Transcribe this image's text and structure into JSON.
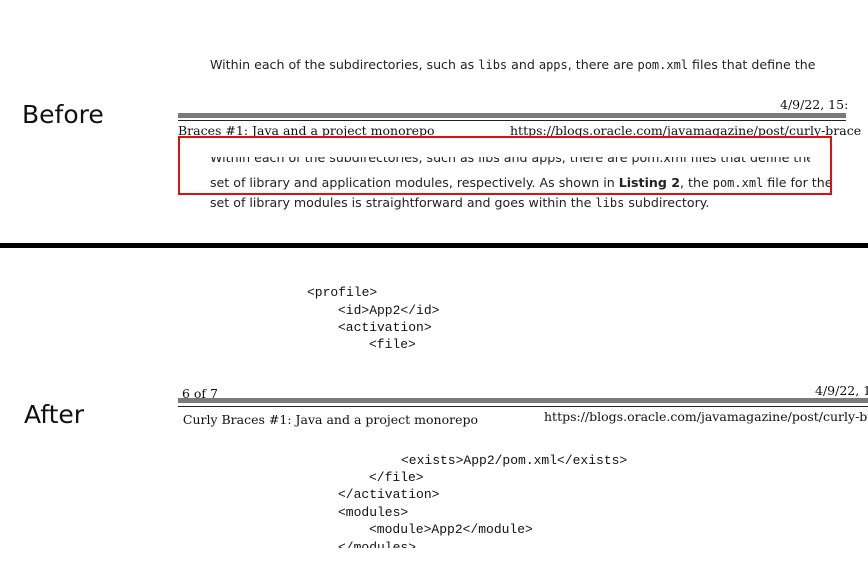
{
  "before": {
    "label": "Before",
    "para_top": {
      "t1": "Within each of the subdirectories, such as ",
      "c1": "libs",
      "t2": " and ",
      "c2": "apps",
      "t3": ", there are ",
      "c3": "pom.xml",
      "t4": " files that define the"
    },
    "header_date": "4/9/22, 15:",
    "header_title": "Braces #1: Java and a project monorepo",
    "header_url": "https://blogs.oracle.com/javamagazine/post/curly-brace",
    "para_clipped": "Within each of the subdirectories, such as libs and apps, there are pom.xml files that define the",
    "line2": {
      "t1": "set of library and application modules, respectively. As shown in ",
      "bold": "Listing 2",
      "t2": ", the ",
      "c1": "pom.xml",
      "t3": " file for the"
    },
    "line3": {
      "t1": "set of library modules is straightforward and goes within the ",
      "c1": "libs",
      "t2": " subdirectory."
    }
  },
  "after": {
    "label": "After",
    "code_top": [
      "<profile>",
      "<id>App2</id>",
      "<activation>",
      "<file>"
    ],
    "footer_page": "6 of 7",
    "header_date": "4/9/22, 1",
    "header_title": "Curly Braces #1: Java and a project monorepo",
    "header_url": "https://blogs.oracle.com/javamagazine/post/curly-bra",
    "code_bottom": [
      "<exists>App2/pom.xml</exists>",
      "</file>",
      "</activation>",
      "<modules>",
      "<module>App2</module>",
      "</modules>"
    ]
  }
}
